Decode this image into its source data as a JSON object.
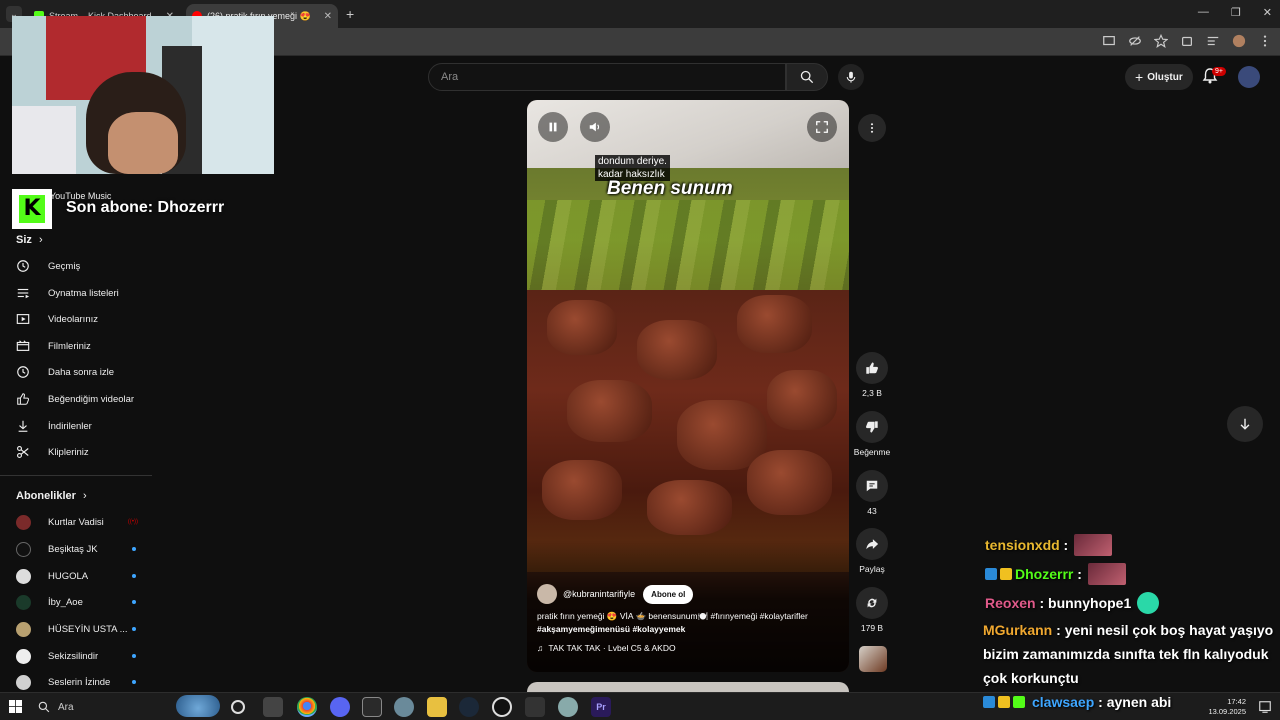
{
  "browser": {
    "tabs": [
      {
        "title": "Stream – Kick Dashboard",
        "favicon_color": "#53fc18"
      },
      {
        "title": "(26) pratik fırın yemeği 😍",
        "favicon_color": "#ff0000"
      }
    ],
    "new_tab": "+"
  },
  "youtube": {
    "search_placeholder": "Ara",
    "create_label": "Oluştur",
    "notification_count": "9+"
  },
  "overlay": {
    "yt_music_label": "YouTube Music",
    "last_subscriber": "Son abone: Dhozerrr"
  },
  "sidebar": {
    "you_header": "Siz",
    "items": [
      {
        "label": "Geçmiş",
        "icon": "history-icon"
      },
      {
        "label": "Oynatma listeleri",
        "icon": "playlists-icon"
      },
      {
        "label": "Videolarınız",
        "icon": "your-videos-icon"
      },
      {
        "label": "Filmleriniz",
        "icon": "movies-icon"
      },
      {
        "label": "Daha sonra izle",
        "icon": "watch-later-icon"
      },
      {
        "label": "Beğendiğim videolar",
        "icon": "liked-videos-icon"
      },
      {
        "label": "İndirilenler",
        "icon": "downloads-icon"
      },
      {
        "label": "Klipleriniz",
        "icon": "clips-icon"
      }
    ],
    "subs_header": "Abonelikler",
    "subscriptions": [
      {
        "label": "Kurtlar Vadisi",
        "color": "#7a2a2a",
        "live": true
      },
      {
        "label": "Beşiktaş JK",
        "color": "#111111"
      },
      {
        "label": "HUGOLA",
        "color": "#dddddd"
      },
      {
        "label": "İby_Aoe",
        "color": "#1a3a2a"
      },
      {
        "label": "HÜSEYİN USTA ...",
        "color": "#b8a070"
      },
      {
        "label": "Sekizsilindir",
        "color": "#eeeeee"
      },
      {
        "label": "Seslerin İzinde",
        "color": "#d0d0d0"
      }
    ]
  },
  "short": {
    "caption_small_1": "dondum deriye.",
    "caption_small_2": "kadar haksızlık",
    "caption_big": "Benen sunum",
    "channel": "@kubranintarifiyle",
    "subscribe_label": "Abone ol",
    "description_1": "pratik fırın yemeği 😍 VİA 🍲 benensunum🍽️ #fırınyemeği #kolaytarifler",
    "description_2": "#akşamyemeğimenüsü #kolayyemek",
    "music": "TAK TAK TAK · Lvbel C5 & AKDO"
  },
  "actions": {
    "likes": "2,3 B",
    "dislike_label": "Beğenme",
    "comments": "43",
    "share_label": "Paylaş",
    "remix_count": "179 B"
  },
  "chat": [
    {
      "user": "tensionxdd",
      "user_color": "#e8b830",
      "text": ""
    },
    {
      "user": "Dhozerrr",
      "user_color": "#53fc18",
      "text": ""
    },
    {
      "user": "Reoxen",
      "user_color": "#e05a8a",
      "text": "bunnyhope1"
    },
    {
      "user": "MGurkann",
      "user_color": "#f0a830",
      "text": "yeni nesil çok boş hayat yaşıyo bizim zamanımızda sınıfta tek fln kalıyoduk çok korkunçtu"
    }
  ],
  "taskbar": {
    "search_label": "Ara",
    "overlay_user": "clawsaep",
    "overlay_text": "aynen abi",
    "time": "17:42",
    "date": "13.09.2025"
  }
}
